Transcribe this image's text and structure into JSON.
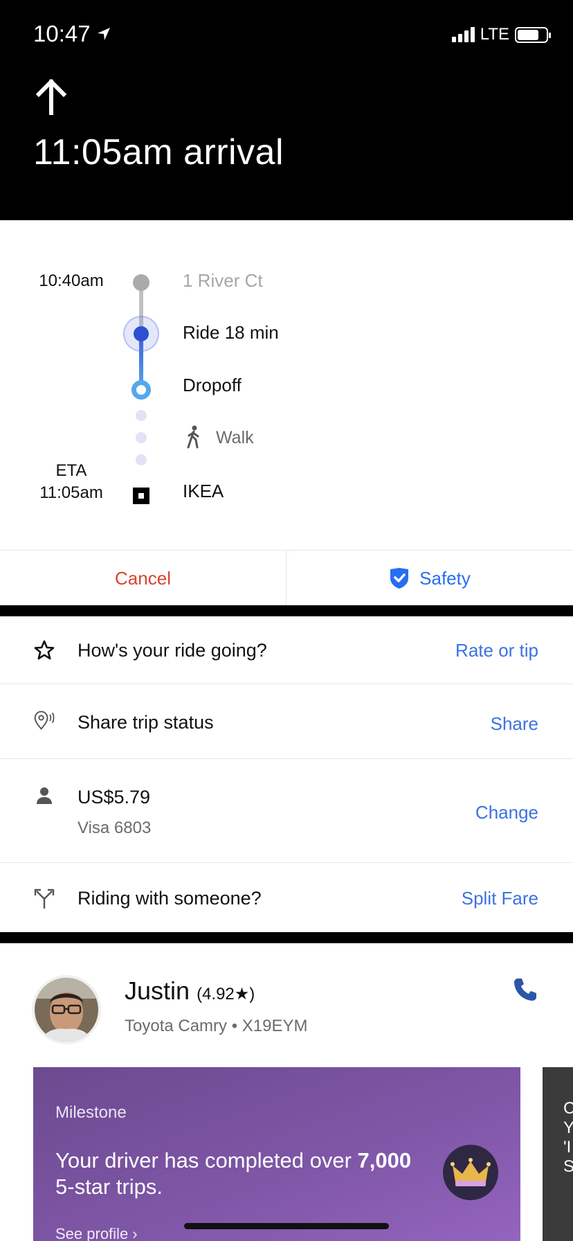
{
  "status_bar": {
    "time": "10:47",
    "network": "LTE"
  },
  "header": {
    "arrival": "11:05am arrival"
  },
  "timeline": {
    "start_time": "10:40am",
    "eta_label": "ETA",
    "eta_time": "11:05am",
    "steps": [
      {
        "label": "1 River Ct"
      },
      {
        "label": "Ride 18 min"
      },
      {
        "label": "Dropoff"
      },
      {
        "label": "Walk"
      },
      {
        "label": "IKEA"
      }
    ]
  },
  "actions": {
    "cancel": "Cancel",
    "safety": "Safety"
  },
  "rows": {
    "rate": {
      "label": "How's your ride going?",
      "action": "Rate or tip"
    },
    "share": {
      "label": "Share trip status",
      "action": "Share"
    },
    "payment": {
      "amount": "US$5.79",
      "card": "Visa 6803",
      "action": "Change"
    },
    "split": {
      "label": "Riding with someone?",
      "action": "Split Fare"
    }
  },
  "driver": {
    "name": "Justin",
    "rating": "(4.92★)",
    "car": "Toyota Camry • X19EYM"
  },
  "milestone": {
    "kicker": "Milestone",
    "message_prefix": "Your driver has completed over ",
    "message_bold": "7,000",
    "message_suffix": " 5-star trips.",
    "link": "See profile ›"
  },
  "next_card_peek": {
    "letters": "C Y 'I S"
  },
  "colors": {
    "accent_blue": "#276ef1",
    "cancel_red": "#d9432c",
    "milestone_purple": "#7e56a6"
  }
}
